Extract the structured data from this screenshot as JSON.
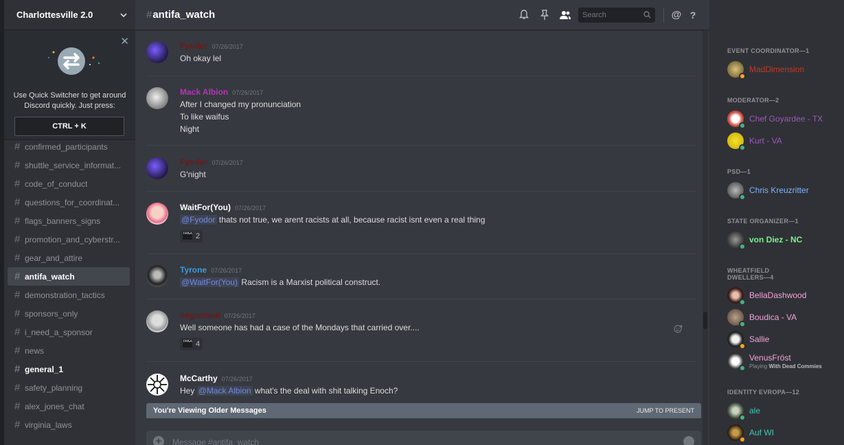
{
  "colors": {
    "online": "#43b581",
    "idle": "#faa61a",
    "mention": "#7289da"
  },
  "server": {
    "name": "Charlottesville 2.0"
  },
  "quick_switcher": {
    "text": "Use Quick Switcher to get around Discord quickly. Just press:",
    "shortcut": "CTRL + K"
  },
  "channels": [
    {
      "name": "confirmed_participants",
      "state": "normal"
    },
    {
      "name": "shuttle_service_informat...",
      "state": "normal"
    },
    {
      "name": "code_of_conduct",
      "state": "normal"
    },
    {
      "name": "questions_for_coordinat...",
      "state": "normal"
    },
    {
      "name": "flags_banners_signs",
      "state": "normal"
    },
    {
      "name": "promotion_and_cyberstr...",
      "state": "normal"
    },
    {
      "name": "gear_and_attire",
      "state": "normal"
    },
    {
      "name": "antifa_watch",
      "state": "active"
    },
    {
      "name": "demonstration_tactics",
      "state": "normal"
    },
    {
      "name": "sponsors_only",
      "state": "normal"
    },
    {
      "name": "i_need_a_sponsor",
      "state": "normal"
    },
    {
      "name": "news",
      "state": "normal"
    },
    {
      "name": "general_1",
      "state": "unread"
    },
    {
      "name": "safety_planning",
      "state": "normal"
    },
    {
      "name": "alex_jones_chat",
      "state": "normal"
    },
    {
      "name": "virginia_laws",
      "state": "normal"
    }
  ],
  "header": {
    "channel": "antifa_watch",
    "search_placeholder": "Search"
  },
  "messages": [
    {
      "author": "Fyodor",
      "color": "#6b1a1a",
      "timestamp": "07/26/2017",
      "lines": [
        [
          "Oh okay lel"
        ]
      ],
      "avatar": "purple"
    },
    {
      "author": "Mack Albion",
      "color": "#b435b8",
      "timestamp": "07/26/2017",
      "lines": [
        [
          "After I changed my pronunciation"
        ],
        [
          "To like waifus"
        ],
        [
          "Night"
        ]
      ],
      "avatar": "white"
    },
    {
      "author": "Fyodor",
      "color": "#6b1a1a",
      "timestamp": "07/26/2017",
      "lines": [
        [
          "G'night"
        ]
      ],
      "avatar": "purple"
    },
    {
      "author": "WaitFor(You)",
      "color": "#ffffff",
      "timestamp": "07/26/2017",
      "lines": [
        [
          "@Fyodor",
          " thats not true,  we arent racists at all, because racist isnt even a real thing"
        ]
      ],
      "reaction": {
        "emoji": "TRIGGERED",
        "count": "2"
      },
      "avatar": "pink"
    },
    {
      "author": "Tyrone",
      "color": "#3e9be0",
      "timestamp": "07/26/2017",
      "lines": [
        [
          "@WaitFor(You)",
          " Racism is a Marxist political construct."
        ]
      ],
      "avatar": "dark"
    },
    {
      "author": "negronaut",
      "color": "#6b1a1a",
      "timestamp": "07/26/2017",
      "lines": [
        [
          "Well someone has had a case of the Mondays that carried over...."
        ]
      ],
      "reaction": {
        "emoji": "TRIGGERED",
        "count": "4"
      },
      "avatar": "grey"
    },
    {
      "author": "McCarthy",
      "color": "#ffffff",
      "timestamp": "07/26/2017",
      "lines": [
        [
          "Hey ",
          "@Mack Albion",
          "  what's the deal with shit talking Enoch?"
        ]
      ],
      "avatar": "snow"
    }
  ],
  "older_bar": {
    "label": "You're Viewing Older Messages",
    "action": "JUMP TO PRESENT"
  },
  "composer": {
    "placeholder": "Message #antifa_watch"
  },
  "member_groups": [
    {
      "role": "EVENT COORDINATOR—1",
      "members": [
        {
          "name": "MadDimension",
          "color": "#c0392b",
          "status": "idle",
          "av": "#8a7a4a"
        }
      ]
    },
    {
      "role": "MODERATOR—2",
      "members": [
        {
          "name": "Chef Goyardee - TX",
          "color": "#9b59b6",
          "status": "online",
          "av": "#c94a3f"
        },
        {
          "name": "Kurt - VA",
          "color": "#9b59b6",
          "status": "online",
          "av": "#e6d31c"
        }
      ]
    },
    {
      "role": "PSD—1",
      "members": [
        {
          "name": "Chris Kreuzritter",
          "color": "#7fb4ff",
          "status": "online",
          "av": "#555"
        }
      ]
    },
    {
      "role": "STATE ORGANIZER—1",
      "members": [
        {
          "name": "von Diez - NC",
          "color": "#7bf18a",
          "status": "online",
          "av": "#333"
        }
      ]
    },
    {
      "role": "WHEATFIELD DWELLERS—4",
      "members": [
        {
          "name": "BellaDashwood",
          "color": "#f5a3d9",
          "status": "online",
          "av": "#5a2e2e"
        },
        {
          "name": "Boudica - VA",
          "color": "#f5a3d9",
          "status": "online",
          "av": "#6b5a4e"
        },
        {
          "name": "Sallie",
          "color": "#f5a3d9",
          "status": "idle",
          "av": "#222"
        },
        {
          "name": "VenusFröst",
          "color": "#f5a3d9",
          "status": "online",
          "av": "#ddd",
          "playing": "Playing",
          "game": "With Dead Commies"
        }
      ]
    },
    {
      "role": "IDENTITY EVROPA—12",
      "members": [
        {
          "name": "ale",
          "color": "#3ec6b8",
          "status": "online",
          "av": "#6e7f6a"
        },
        {
          "name": "Auf WI",
          "color": "#3ec6b8",
          "status": "idle",
          "av": "#3b2e1c"
        }
      ]
    }
  ]
}
